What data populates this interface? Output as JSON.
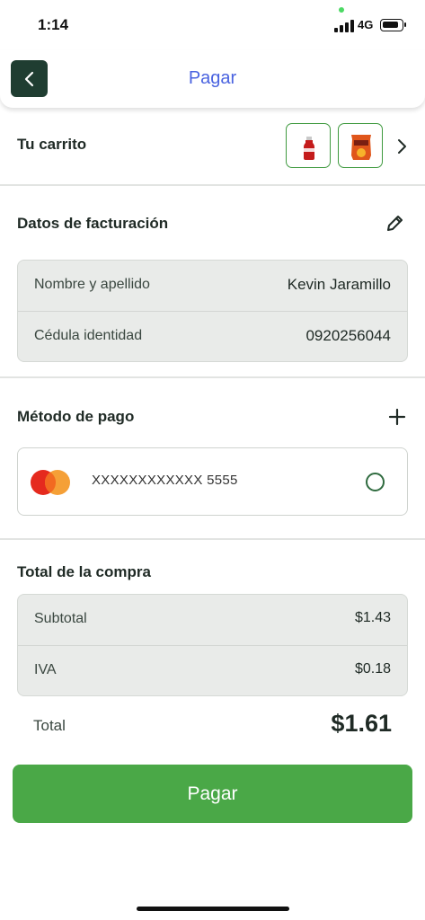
{
  "status_bar": {
    "time": "1:14",
    "network": "4G"
  },
  "header": {
    "title": "Pagar"
  },
  "cart": {
    "label": "Tu carrito",
    "items": [
      "soda-bottle",
      "snack-bag"
    ]
  },
  "billing": {
    "title": "Datos de facturación",
    "rows": [
      {
        "label": "Nombre y apellido",
        "value": "Kevin Jaramillo"
      },
      {
        "label": "Cédula identidad",
        "value": "0920256044"
      }
    ]
  },
  "payment": {
    "title": "Método de pago",
    "card_number": "XXXXXXXXXXXX 5555",
    "card_brand": "mastercard"
  },
  "purchase": {
    "title": "Total de la compra",
    "rows": [
      {
        "label": "Subtotal",
        "value": "$1.43"
      },
      {
        "label": "IVA",
        "value": "$0.18"
      }
    ],
    "total_label": "Total",
    "total_value": "$1.61"
  },
  "pay_button": {
    "label": "Pagar"
  },
  "colors": {
    "primary_green": "#4aa847",
    "dark_green": "#1f3d31",
    "title_blue": "#4a63e0"
  }
}
